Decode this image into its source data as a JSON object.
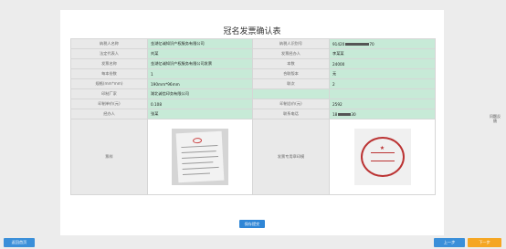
{
  "page_title": "冠名发票确认表",
  "rows": [
    {
      "l1": "纳税人名称",
      "v1": "金湖亿诚知识产权服务有限公司",
      "l2": "纳税人识别号",
      "v2_pre": "91420",
      "v2_post": "70"
    },
    {
      "l1": "法定代表人",
      "v1": "刘某",
      "l2": "发票经办人",
      "v2": "李某某"
    },
    {
      "l1": "发票名称",
      "v1": "金湖亿诚知识产权服务有限公司发票",
      "l2": "本数",
      "v2": "24000"
    },
    {
      "l1": "每本份数",
      "v1": "1",
      "l2": "合联版本",
      "v2": "无"
    },
    {
      "l1": "规格(mm*mm)",
      "v1": "190mm*96mm",
      "l2": "联次",
      "v2": "2"
    },
    {
      "l1": "印制厂家",
      "v1": "湖北诚信印务有限公司",
      "l2": "",
      "v2": ""
    },
    {
      "l1": "印制单价(元)",
      "v1": "0.108",
      "l2": "印制总价(元)",
      "v2": "2592"
    },
    {
      "l1": "经办人",
      "v1": "张某",
      "l2": "联系电话",
      "v2_pre": "18",
      "v2_post": "30"
    }
  ],
  "image_row": {
    "label1": "票样",
    "label2": "发票专用章印模"
  },
  "buttons": {
    "save": "保存提交",
    "back": "返回首页",
    "prev": "上一步",
    "next": "下一步",
    "help": "问题反馈"
  }
}
